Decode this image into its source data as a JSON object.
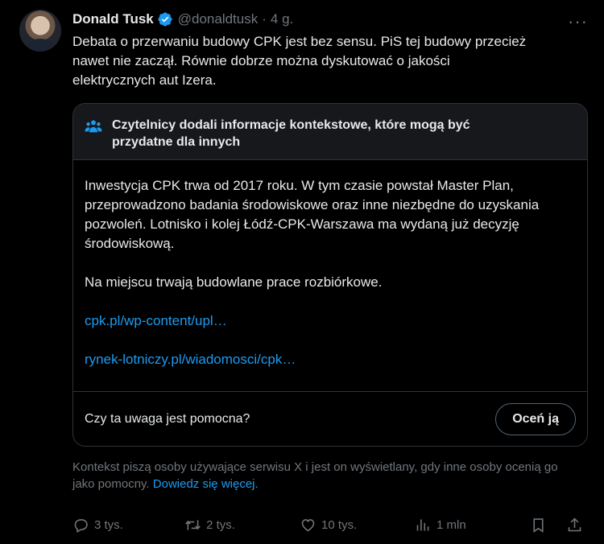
{
  "author": {
    "name": "Donald Tusk",
    "handle": "@donaldtusk",
    "separator": "·",
    "time": "4 g.",
    "more_icon": "more-horizontal-icon",
    "verified_color": "#1d9bf0"
  },
  "tweet": {
    "text": "Debata o przerwaniu budowy CPK jest bez sensu. PiS tej budowy przecież\nnawet nie zaczął. Równie dobrze można dyskutować o jakości\nelektrycznych aut Izera."
  },
  "community_note": {
    "title": "Czytelnicy dodali informacje kontekstowe, które mogą być przydatne dla innych",
    "paragraph_1": "Inwestycja CPK trwa od 2017 roku. W tym czasie powstał Master Plan, przeprowadzono badania środowiskowe oraz inne niezbędne do uzyskania pozwoleń. Lotnisko i kolej Łódź-CPK-Warszawa ma wydaną już decyzję środowiskową.",
    "paragraph_2": "Na miejscu trwają  budowlane prace rozbiórkowe.",
    "link_1": "cpk.pl/wp-content/upl…",
    "link_2": "rynek-lotniczy.pl/wiadomosci/cpk…",
    "helpful_question": "Czy ta uwaga jest pomocna?",
    "rate_button": "Oceń ją",
    "icon": "people-icon"
  },
  "footnote": {
    "text": "Kontekst piszą osoby używające serwisu X i jest on wyświetlany, gdy inne osoby ocenią go jako pomocny.",
    "link": "Dowiedz się więcej."
  },
  "actions": {
    "replies": "3 tys.",
    "reposts": "2 tys.",
    "likes": "10 tys.",
    "views": "1 mln"
  },
  "colors": {
    "background": "#000000",
    "accent": "#1d9bf0",
    "muted": "#71767b",
    "border": "#2f3336"
  }
}
